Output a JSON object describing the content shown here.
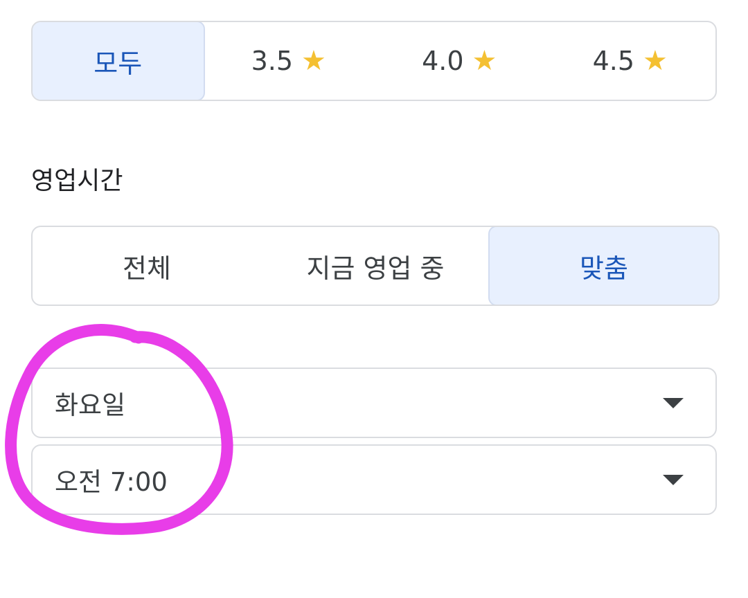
{
  "rating_filter": {
    "options": [
      {
        "label": "모두",
        "selected": true,
        "star": false
      },
      {
        "label": "3.5",
        "selected": false,
        "star": true
      },
      {
        "label": "4.0",
        "selected": false,
        "star": true
      },
      {
        "label": "4.5",
        "selected": false,
        "star": true
      }
    ],
    "star_glyph": "★",
    "star_color": "#f4c032"
  },
  "hours_section": {
    "title": "영업시간",
    "options": [
      {
        "label": "전체",
        "selected": false
      },
      {
        "label": "지금 영업 중",
        "selected": false
      },
      {
        "label": "맞춤",
        "selected": true
      }
    ]
  },
  "day_select": {
    "value": "화요일",
    "icon": "dropdown-caret-icon"
  },
  "time_select": {
    "value": "오전 7:00",
    "icon": "dropdown-caret-icon"
  },
  "colors": {
    "selected_bg": "#e8f0fe",
    "selected_text": "#1a56b8",
    "annotation": "#e83de8"
  }
}
